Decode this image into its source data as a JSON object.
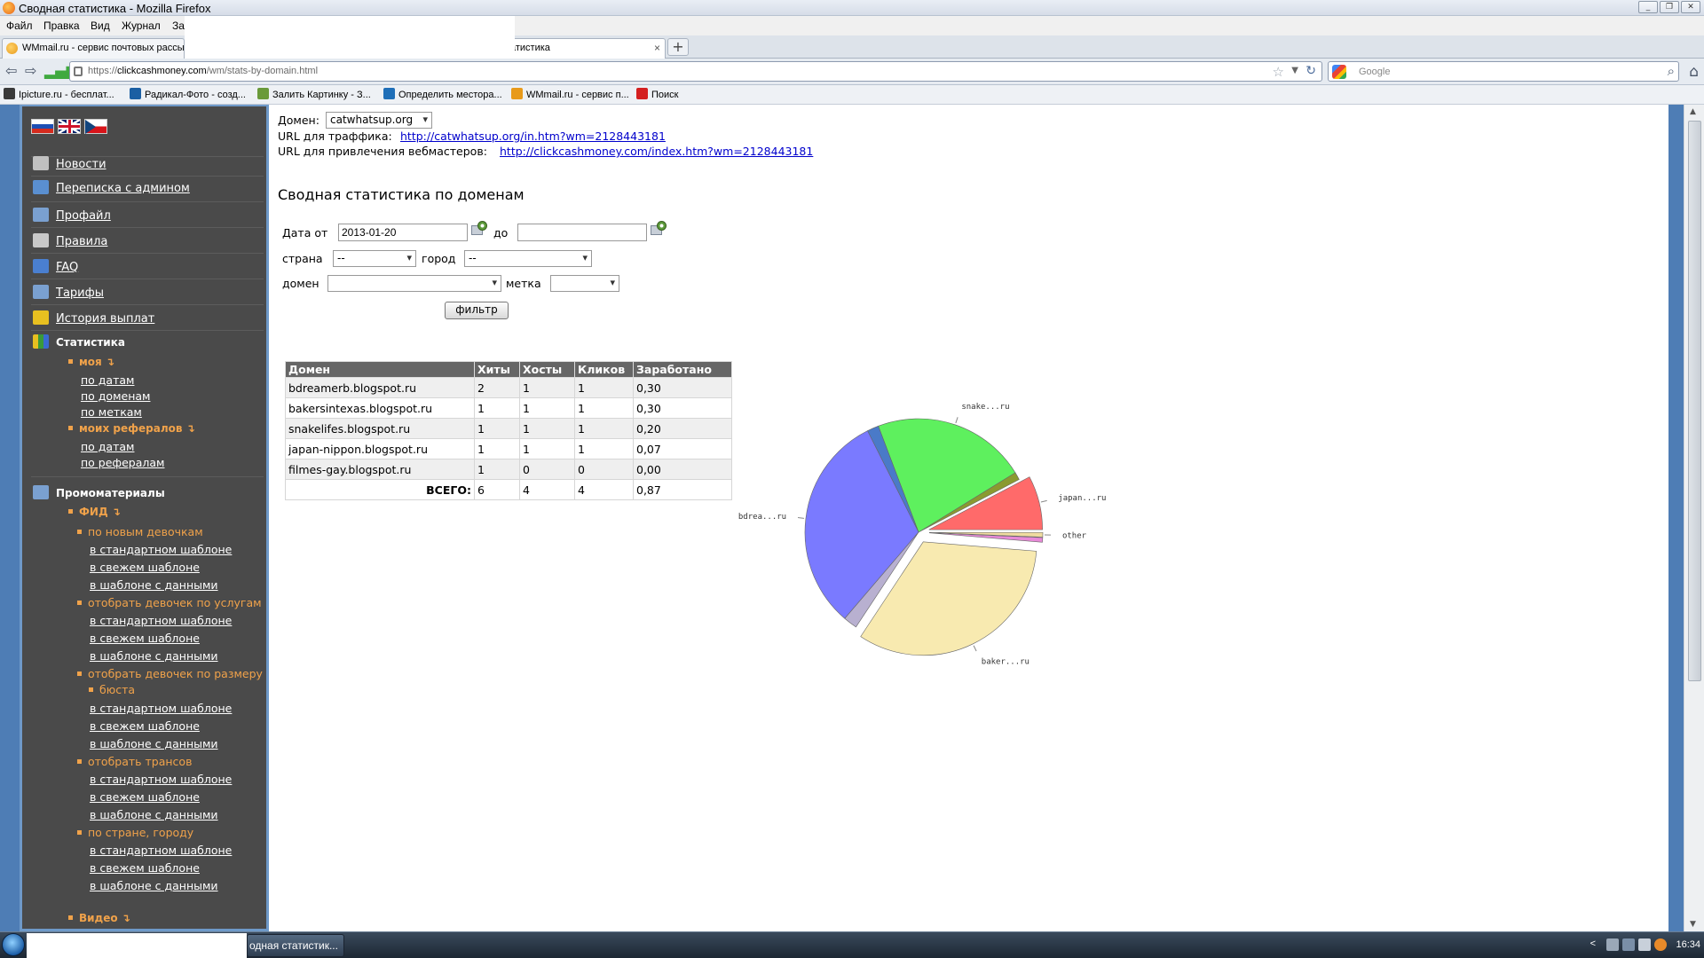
{
  "window": {
    "title": "Сводная статистика - Mozilla Firefox",
    "buttons": [
      "_",
      "❐",
      "✕"
    ]
  },
  "menu": [
    "Файл",
    "Правка",
    "Вид",
    "Журнал",
    "За"
  ],
  "tabs": [
    {
      "label": "WMmail.ru - сервис почтовых рассы"
    },
    {
      "label": "атистика",
      "close": "×"
    }
  ],
  "newtab": "+",
  "nav": {
    "url_prefix": "https://",
    "url_host": "clickcashmoney.com",
    "url_path": "/wm/stats-by-domain.html",
    "search_placeholder": "Google"
  },
  "bookmarks": [
    {
      "label": "Ipicture.ru - бесплат...",
      "color": "#3a3a3a"
    },
    {
      "label": "Радикал-Фото - созд...",
      "color": "#1b5fa3"
    },
    {
      "label": "Залить Картинку - З...",
      "color": "#6a9a3a"
    },
    {
      "label": "Определить местора...",
      "color": "#1f6fb8"
    },
    {
      "label": "WMmail.ru - сервис п...",
      "color": "#e89a1a"
    },
    {
      "label": "Поиск",
      "color": "#d42020"
    }
  ],
  "sidebar": {
    "items": [
      {
        "label": "Новости",
        "icon": "news-icon",
        "color": "#c0c0c0"
      },
      {
        "label": "Переписка с админом",
        "icon": "mail-icon",
        "color": "#5a8fd0"
      },
      {
        "label": "Профайл",
        "icon": "tools-icon",
        "color": "#7aa0d0"
      },
      {
        "label": "Правила",
        "icon": "book-icon",
        "color": "#c8c8c8"
      },
      {
        "label": "FAQ",
        "icon": "faq-icon",
        "color": "#4a7fd0"
      },
      {
        "label": "Тарифы",
        "icon": "tools-icon",
        "color": "#7aa0d0"
      },
      {
        "label": "История выплат",
        "icon": "hourglass-icon",
        "color": "#e8c020"
      }
    ],
    "stats": {
      "label": "Статистика",
      "my": "моя ↴",
      "my_links": [
        "по датам",
        "по доменам",
        "по меткам"
      ],
      "refs": "моих рефералов ↴",
      "refs_links": [
        "по датам",
        "по рефералам"
      ]
    },
    "promo": {
      "label": "Промоматериалы",
      "feed": "ФИД ↴",
      "groups": [
        {
          "label": "по новым девочкам"
        },
        {
          "label": "отобрать девочек по услугам"
        },
        {
          "label": "отобрать девочек по размеру"
        },
        {
          "label": "отобрать трансов"
        },
        {
          "label": "по стране, городу"
        }
      ],
      "groups_line2": "бюста",
      "links": [
        "в стандартном шаблоне",
        "в свежем шаблоне",
        "в шаблоне с данными"
      ],
      "video": "Видео ↴"
    }
  },
  "content": {
    "domain_label": "Домен:",
    "domain_value": "catwhatsup.org",
    "traffic_label": "URL для траффика:",
    "traffic_url": "http://catwhatsup.org/in.htm?wm=2128443181",
    "webmaster_label": "URL для привлечения вебмастеров:",
    "webmaster_url": "http://clickcashmoney.com/index.htm?wm=2128443181",
    "heading": "Сводная статистика по доменам",
    "filters": {
      "date_from_label": "Дата от",
      "date_from": "2013-01-20",
      "date_to_label": "до",
      "date_to": "",
      "country_label": "страна",
      "country_value": "--",
      "city_label": "город",
      "city_value": "--",
      "domain_label": "домен",
      "domain_value": "",
      "tag_label": "метка",
      "tag_value": "",
      "filter_button": "фильтр"
    },
    "table": {
      "headers": [
        "Домен",
        "Хиты",
        "Хосты",
        "Кликов",
        "Заработано"
      ],
      "rows": [
        [
          "bdreamerb.blogspot.ru",
          "2",
          "1",
          "1",
          "0,30"
        ],
        [
          "bakersintexas.blogspot.ru",
          "1",
          "1",
          "1",
          "0,30"
        ],
        [
          "snakelifes.blogspot.ru",
          "1",
          "1",
          "1",
          "0,20"
        ],
        [
          "japan-nippon.blogspot.ru",
          "1",
          "1",
          "1",
          "0,07"
        ],
        [
          "filmes-gay.blogspot.ru",
          "1",
          "0",
          "0",
          "0,00"
        ]
      ],
      "total": [
        "ВСЕГО:",
        "6",
        "4",
        "4",
        "0,87"
      ]
    }
  },
  "chart_data": {
    "type": "pie",
    "slices": [
      {
        "label": "japan...ru",
        "value": 0.07,
        "color": "#ff6a6a"
      },
      {
        "label": "",
        "value": 0.01,
        "color": "#8a9a30"
      },
      {
        "label": "snake...ru",
        "value": 0.2,
        "color": "#5ef05e"
      },
      {
        "label": "",
        "value": 0.015,
        "color": "#4a7ac8"
      },
      {
        "label": "bdrea...ru",
        "value": 0.285,
        "color": "#7a7aff"
      },
      {
        "label": "",
        "value": 0.018,
        "color": "#b8b0d0"
      },
      {
        "label": "baker...ru",
        "value": 0.3,
        "color": "#f8eab0"
      },
      {
        "label": "",
        "value": 0.006,
        "color": "#e88ad8"
      },
      {
        "label": "other",
        "value": 0.006,
        "color": "#f0dca0"
      }
    ],
    "exploded": [
      0,
      6,
      7,
      8
    ]
  },
  "taskbar": {
    "task_label": "одная статистик...",
    "time": "16:34",
    "tray_chevron": "<"
  }
}
